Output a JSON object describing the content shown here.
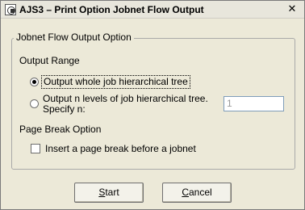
{
  "window": {
    "title": "AJS3 – Print Option Jobnet Flow Output",
    "close_symbol": "✕",
    "app_icon": "ajs-app-icon"
  },
  "group": {
    "title": "Jobnet Flow Output Option"
  },
  "output_range": {
    "label": "Output Range",
    "option_whole": "Output whole job hierarchical tree",
    "option_whole_selected": true,
    "option_levels_line1": "Output n levels of job hierarchical tree.",
    "option_levels_line2": "Specify n:",
    "option_levels_selected": false,
    "n_value": "1"
  },
  "page_break": {
    "label": "Page Break Option",
    "checkbox_label": "Insert a page break before a jobnet",
    "checked": false
  },
  "buttons": {
    "start_mnemonic": "S",
    "start_rest": "tart",
    "cancel_mnemonic": "C",
    "cancel_rest": "ancel"
  }
}
